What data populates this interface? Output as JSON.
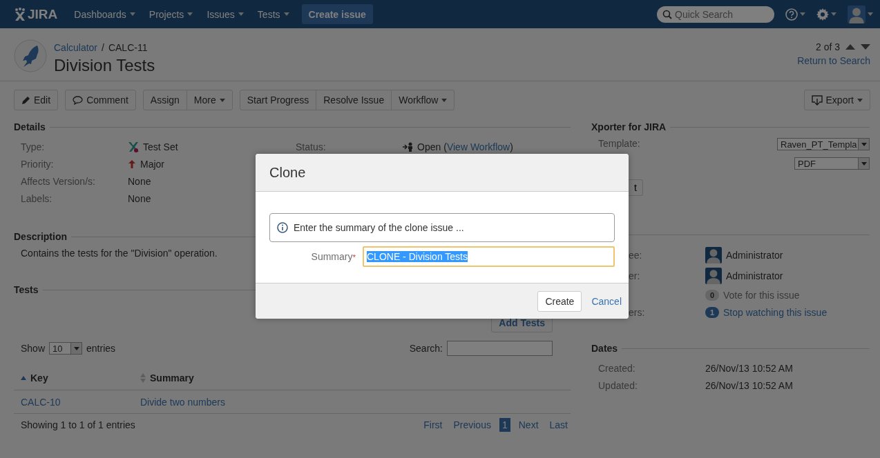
{
  "header": {
    "logo": "JIRA",
    "nav": [
      {
        "label": "Dashboards"
      },
      {
        "label": "Projects"
      },
      {
        "label": "Issues"
      },
      {
        "label": "Tests"
      }
    ],
    "create_button": "Create issue",
    "search": {
      "placeholder": "Quick Search"
    }
  },
  "issue": {
    "project": "Calculator",
    "separator": "/",
    "key": "CALC-11",
    "title": "Division Tests",
    "pager": "2 of 3",
    "return_link": "Return to Search"
  },
  "toolbar": [
    {
      "buttons": [
        {
          "label": "Edit",
          "dropdown": false
        }
      ]
    },
    {
      "buttons": [
        {
          "label": "Comment",
          "dropdown": false
        }
      ]
    },
    {
      "buttons": [
        {
          "label": "Assign",
          "dropdown": false
        },
        {
          "label": "More",
          "dropdown": true
        }
      ]
    },
    {
      "buttons": [
        {
          "label": "Start Progress",
          "dropdown": false
        },
        {
          "label": "Resolve Issue",
          "dropdown": false
        },
        {
          "label": "Workflow",
          "dropdown": true
        }
      ]
    }
  ],
  "export": {
    "label": "Export"
  },
  "details": {
    "title": "Details",
    "rows": [
      {
        "label": "Type:",
        "value": "Test Set"
      },
      {
        "label": "Priority:",
        "value": "Major"
      },
      {
        "label": "Affects Version/s:",
        "value": "None"
      },
      {
        "label": "Labels:",
        "value": "None"
      }
    ],
    "status": {
      "label": "Status:",
      "value": "Open",
      "prefix": "(",
      "link": "View Workflow",
      "suffix": ")"
    }
  },
  "description": {
    "title": "Description",
    "text": "Contains the tests for the \"Division\" operation."
  },
  "tests": {
    "title": "Tests",
    "add_button": "Add Tests",
    "show_label": "Show",
    "page_size": "10",
    "entries_label": "entries",
    "search_label": "Search:",
    "columns": [
      {
        "label": "Key"
      },
      {
        "label": "Summary"
      }
    ],
    "rows": [
      {
        "key": "CALC-10",
        "summary": "Divide two numbers"
      }
    ],
    "info": "Showing 1 to 1 of 1 entries",
    "pagination": [
      {
        "label": "First",
        "selected": false
      },
      {
        "label": "Previous",
        "selected": false
      },
      {
        "label": "1",
        "selected": true
      },
      {
        "label": "Next",
        "selected": false
      },
      {
        "label": "Last",
        "selected": false
      }
    ]
  },
  "xporter": {
    "title": "Xporter for JIRA",
    "template_label": "Template:",
    "template": "Raven_PT_Templa",
    "format": "PDF",
    "button": "t"
  },
  "people": {
    "rows": [
      {
        "label": "ee:",
        "kind": "user",
        "value": "Administrator"
      },
      {
        "label": "er:",
        "kind": "user",
        "value": "Administrator"
      },
      {
        "kind": "count",
        "count": "0",
        "value": "Vote for this issue",
        "active": false
      },
      {
        "label": "ers:",
        "kind": "count",
        "count": "1",
        "value": "Stop watching this issue",
        "active": true
      }
    ]
  },
  "dates": {
    "title": "Dates",
    "rows": [
      {
        "label": "Created:",
        "value": "26/Nov/13 10:52 AM"
      },
      {
        "label": "Updated:",
        "value": "26/Nov/13 10:52 AM"
      }
    ]
  },
  "dialog": {
    "title": "Clone",
    "info": "Enter the summary of the clone issue ...",
    "field_label": "Summary",
    "required_mark": "*",
    "value": "CLONE - Division Tests",
    "value_selected": true,
    "create_button": "Create",
    "cancel_link": "Cancel"
  }
}
